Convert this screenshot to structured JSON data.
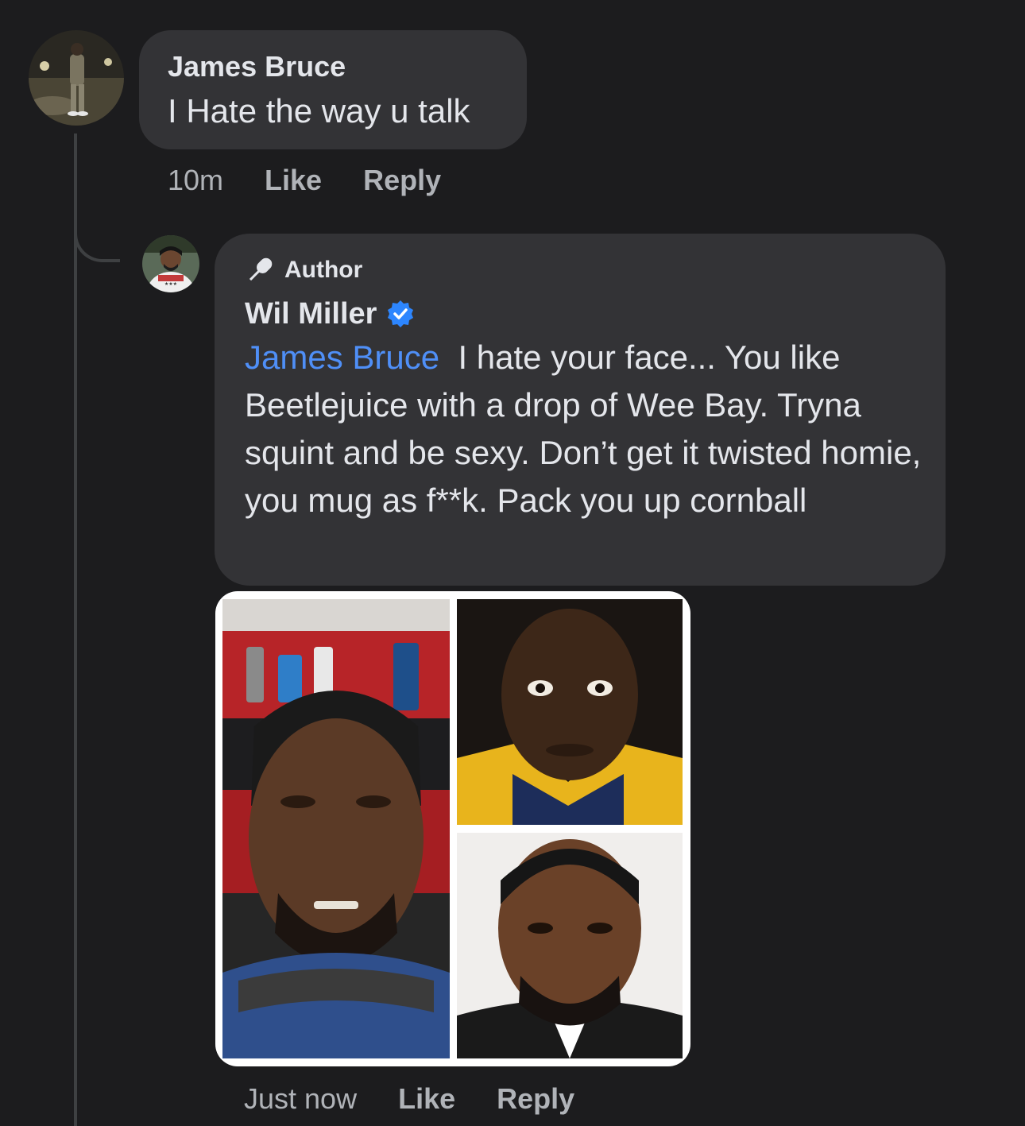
{
  "comment1": {
    "author": "James Bruce",
    "text": "I Hate the way u talk",
    "time": "10m",
    "like_label": "Like",
    "reply_label": "Reply"
  },
  "reply1": {
    "badge_label": "Author",
    "badge_icon": "microphone-icon",
    "author": "Wil Miller",
    "verified_icon": "verified-badge-icon",
    "mention": "James Bruce",
    "text": "I hate your face... You like Beetlejuice with a drop of Wee Bay. Tryna squint and be sexy. Don’t get it twisted homie, you mug as f**k. Pack you up cornball",
    "time": "Just now",
    "like_label": "Like",
    "reply_label": "Reply"
  },
  "colors": {
    "background": "#1c1c1e",
    "bubble": "#333336",
    "mention": "#4f8ff7",
    "verified": "#2d86ff",
    "meta_text": "#b0b3b8"
  }
}
